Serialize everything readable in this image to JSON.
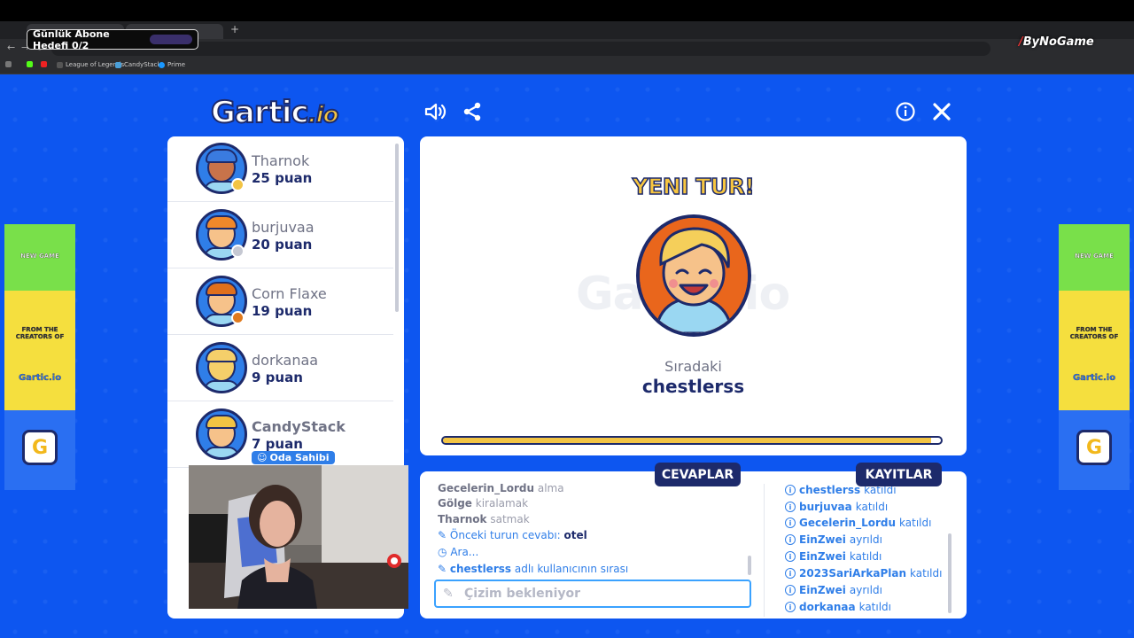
{
  "stream_overlay": {
    "goal_label": "Günlük Abone Hedefi 0/2"
  },
  "bynogame": {
    "logo": "ByNoGame"
  },
  "browser": {
    "bookmarks": [
      "League of Legends",
      "CandyStack",
      "Prime"
    ]
  },
  "game": {
    "logo_main": "Gartic",
    "logo_suffix": ".io",
    "new_round": "YENI TUR!",
    "next_label": "Sıradaki",
    "next_name": "chestlerss",
    "progress": 0.98,
    "tabs": {
      "answers": "CEVAPLAR",
      "logs": "KAYITLAR"
    },
    "draw_placeholder": "Çizim bekleniyor",
    "players": [
      {
        "name": "Tharnok",
        "score": "25 puan",
        "badge_color": "#f2c444",
        "skin": "#c8734a",
        "hair": "#3a7be0"
      },
      {
        "name": "burjuvaa",
        "score": "20 puan",
        "badge_color": "#c5c8d2",
        "skin": "#f6c28a",
        "hair": "#f0882a"
      },
      {
        "name": "Corn Flaxe",
        "score": "19 puan",
        "badge_color": "#e07a1e",
        "skin": "#f6c28a",
        "hair": "#e0701c"
      },
      {
        "name": "dorkanaa",
        "score": "9 puan",
        "badge_color": "",
        "skin": "#f5cf6a",
        "hair": "#f5cf6a"
      },
      {
        "name": "CandyStack",
        "score": "7 puan",
        "badge_color": "",
        "skin": "#f6c28a",
        "hair": "#f2c444",
        "owner": "Oda Sahibi"
      }
    ],
    "answers": [
      {
        "user": "Gecelerin_Lordu",
        "word": "alma"
      },
      {
        "user": "Gölge",
        "word": "kiralamak"
      },
      {
        "user": "Tharnok",
        "word": "satmak"
      }
    ],
    "system_msgs": {
      "prev_answer_label": "Önceki turun cevabı:",
      "prev_answer_value": "otel",
      "break": "Ara...",
      "turn_user": "chestlerss",
      "turn_suffix": "adlı kullanıcının sırası"
    },
    "logs": [
      {
        "user": "chestlerss",
        "action": "katıldı"
      },
      {
        "user": "burjuvaa",
        "action": "katıldı"
      },
      {
        "user": "Gecelerin_Lordu",
        "action": "katıldı"
      },
      {
        "user": "EinZwei",
        "action": "ayrıldı"
      },
      {
        "user": "EinZwei",
        "action": "katıldı"
      },
      {
        "user": "2023SariArkaPlan",
        "action": "katıldı"
      },
      {
        "user": "EinZwei",
        "action": "ayrıldı"
      },
      {
        "user": "dorkanaa",
        "action": "katıldı"
      }
    ],
    "side_ad": {
      "line1": "NEW GAME",
      "line2": "FROM THE CREATORS OF",
      "logo": "Gartic.io",
      "g": "G"
    }
  }
}
